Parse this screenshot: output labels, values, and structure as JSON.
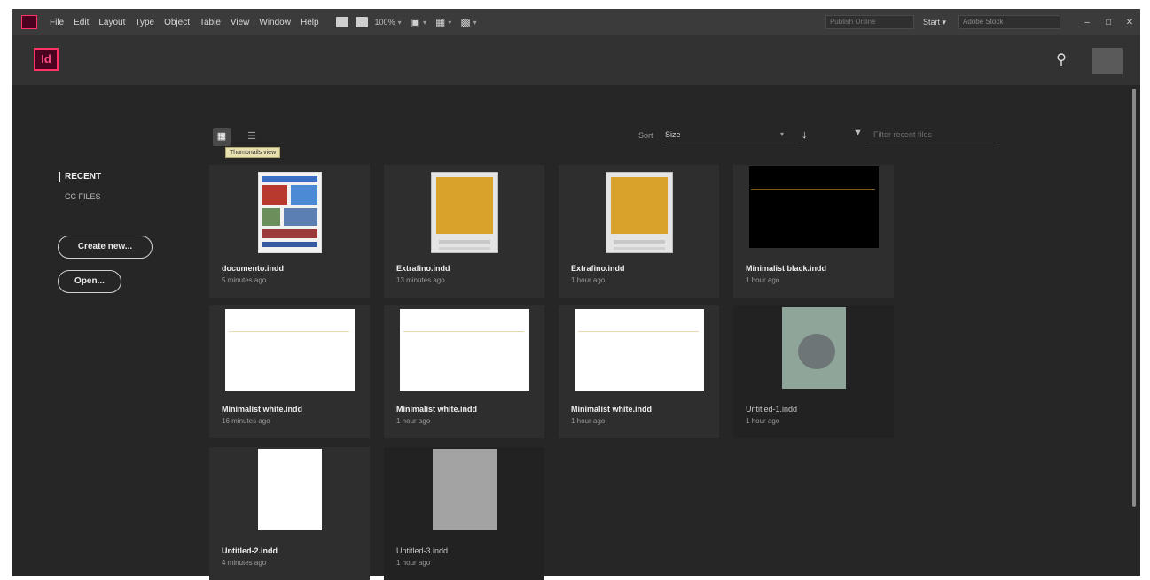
{
  "menubar": {
    "items": [
      "File",
      "Edit",
      "Layout",
      "Type",
      "Object",
      "Table",
      "View",
      "Window",
      "Help"
    ],
    "zoom": "100%",
    "find_placeholder": "Publish Online",
    "workspace": "Start",
    "search_placeholder": "Adobe Stock",
    "window_controls": [
      "–",
      "□",
      "✕"
    ]
  },
  "header": {
    "logo": "Id"
  },
  "sidebar": {
    "recent": "RECENT",
    "cc_files": "CC FILES",
    "create_new": "Create new...",
    "open": "Open..."
  },
  "toolbar": {
    "tooltip": "Thumbnails view",
    "sort_label": "Sort",
    "sort_value": "Size",
    "filter_placeholder": "Filter recent files"
  },
  "files": [
    {
      "name": "documento.indd",
      "time": "5 minutes ago",
      "thumb": "doc"
    },
    {
      "name": "Extrafino.indd",
      "time": "13 minutes ago",
      "thumb": "orange"
    },
    {
      "name": "Extrafino.indd",
      "time": "1 hour ago",
      "thumb": "orange"
    },
    {
      "name": "Minimalist black.indd",
      "time": "1 hour ago",
      "thumb": "black"
    },
    {
      "name": "Minimalist white.indd",
      "time": "16 minutes ago",
      "thumb": "white"
    },
    {
      "name": "Minimalist white.indd",
      "time": "1 hour ago",
      "thumb": "white"
    },
    {
      "name": "Minimalist white.indd",
      "time": "1 hour ago",
      "thumb": "white"
    },
    {
      "name": "Untitled-1.indd",
      "time": "1 hour ago",
      "thumb": "photo"
    },
    {
      "name": "Untitled-2.indd",
      "time": "4 minutes ago",
      "thumb": "page"
    },
    {
      "name": "Untitled-3.indd",
      "time": "1 hour ago",
      "thumb": "gray"
    }
  ]
}
